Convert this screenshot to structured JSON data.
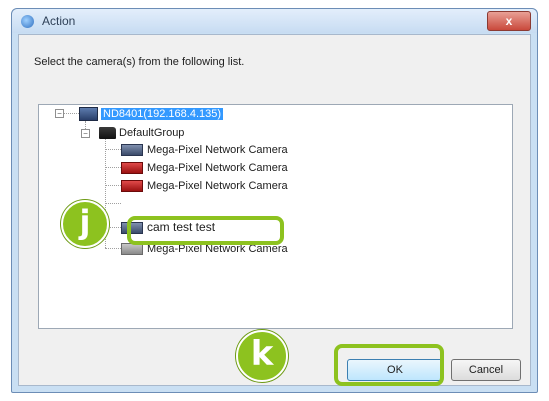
{
  "window": {
    "title": "Action",
    "close_glyph": "x"
  },
  "instruction": "Select the camera(s) from the following list.",
  "tree": {
    "root_label": "ND8401(192.168.4.135)",
    "group_label": "DefaultGroup",
    "cameras": [
      {
        "label": "Mega-Pixel Network Camera",
        "icon": "camera-icon"
      },
      {
        "label": "Mega-Pixel Network Camera",
        "icon": "camera-error-icon"
      },
      {
        "label": "Mega-Pixel Network Camera",
        "icon": "camera-error-icon"
      },
      {
        "label": "cam test test",
        "icon": "camera-icon"
      },
      {
        "label": "Mega-Pixel Network Camera",
        "icon": "camera-offline-icon"
      }
    ],
    "expanders": {
      "root": "−",
      "group": "−"
    }
  },
  "buttons": {
    "ok": "OK",
    "cancel": "Cancel"
  },
  "callouts": {
    "j": "j",
    "k": "k"
  },
  "colors": {
    "callout": "#8dc21f",
    "selection": "#3399ff"
  }
}
